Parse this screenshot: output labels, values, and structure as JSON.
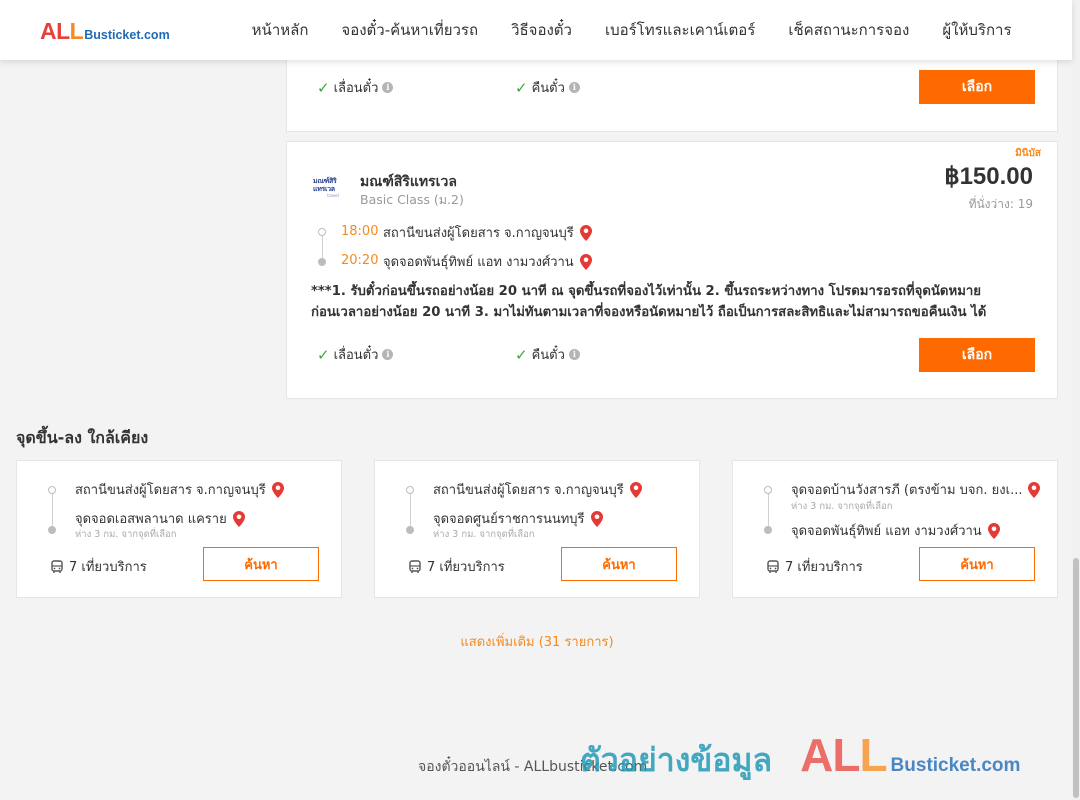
{
  "logo": {
    "part1": "AL",
    "part2": "L",
    "rest": "Busticket.com"
  },
  "nav": [
    "หน้าหลัก",
    "จองตั๋ว-ค้นหาเที่ยวรถ",
    "วิธีจองตั๋ว",
    "เบอร์โทรและเคาน์เตอร์",
    "เช็คสถานะการจอง",
    "ผู้ให้บริการ"
  ],
  "features": {
    "change": "เลื่อนตั๋ว",
    "refund": "คืนตั๋ว",
    "info_glyph": "i"
  },
  "select_label": "เลือก",
  "trip": {
    "badge": "มินิบัส",
    "operator_logo": {
      "line1": "มณฑ์สิริ แทรเวล",
      "line2": "travel"
    },
    "operator": "มณฑ์สิริแทรเวล",
    "class": "Basic Class (ม.2)",
    "price": "฿150.00",
    "seats": "ที่นั่งว่าง: 19",
    "depart_time": "18:00",
    "depart_stop": "สถานีขนส่งผู้โดยสาร จ.กาญจนบุรี",
    "arrive_time": "20:20",
    "arrive_stop": "จุดจอดพันธุ์ทิพย์ แอท งามวงศ์วาน",
    "note_line1": "***1. รับตั๋วก่อนขึ้นรถอย่างน้อย 20 นาที ณ จุดขึ้นรถที่จองไว้เท่านั้น 2. ขึ้นรถระหว่างทาง โปรดมารอรถที่จุดนัดหมาย",
    "note_line2": "ก่อนเวลาอย่างน้อย 20 นาที 3. มาไม่ทันตามเวลาที่จองหรือนัดหมายไว้ ถือเป็นการสละสิทธิและไม่สามารถขอคืนเงิน ได้"
  },
  "nearby": {
    "title": "จุดขึ้น-ลง ใกล้เคียง",
    "search_label": "ค้นหา",
    "cards": [
      {
        "from": "สถานีขนส่งผู้โดยสาร จ.กาญจนบุรี",
        "from_sub": "",
        "to": "จุดจอดเอสพลานาด แคราย",
        "to_sub": "ห่าง 3 กม. จากจุดที่เลือก",
        "trips": "7 เที่ยวบริการ"
      },
      {
        "from": "สถานีขนส่งผู้โดยสาร จ.กาญจนบุรี",
        "from_sub": "",
        "to": "จุดจอดศูนย์ราชการนนทบุรี",
        "to_sub": "ห่าง 3 กม. จากจุดที่เลือก",
        "trips": "7 เที่ยวบริการ"
      },
      {
        "from": "จุดจอดบ้านวังสารภี (ตรงข้าม บจก. ยงเ...",
        "from_sub": "ห่าง 3 กม. จากจุดที่เลือก",
        "to": "จุดจอดพันธุ์ทิพย์ แอท งามวงศ์วาน",
        "to_sub": "",
        "trips": "7 เที่ยวบริการ"
      }
    ]
  },
  "show_more": "แสดงเพิ่มเติม (31 รายการ)",
  "footer": "จองตั๋วออนไลน์ - ALLbusticket.com",
  "watermark": {
    "thai": "ตัวอย่างข้อมูล",
    "part1": "AL",
    "part2": "L",
    "rest": "Busticket.com"
  },
  "colors": {
    "primary": "#ff6a00",
    "accent": "#f58a1f",
    "check": "#3aa83a",
    "pin": "#e53935"
  }
}
